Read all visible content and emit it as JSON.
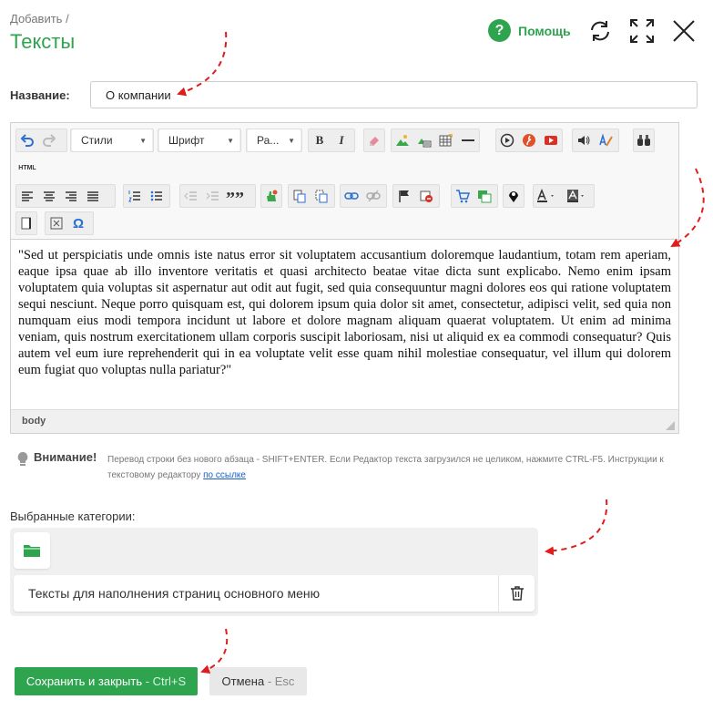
{
  "header": {
    "breadcrumb": "Добавить /",
    "title": "Тексты",
    "help_label": "Помощь",
    "help_icon": "question-circle-icon",
    "refresh_icon": "refresh-icon",
    "fullscreen_icon": "expand-icon",
    "close_icon": "close-icon",
    "accent_color": "#2ea44f"
  },
  "form": {
    "name_label": "Название:",
    "name_value": "О компании"
  },
  "editor": {
    "toolbar": {
      "styles_label": "Стили",
      "font_label": "Шрифт",
      "size_label": "Ра...",
      "bold": "B",
      "italic": "I",
      "html_label": "HTML",
      "quote": "””",
      "omega": "Ω"
    },
    "content": "\"Sed ut perspiciatis unde omnis iste natus error sit voluptatem accusantium doloremque laudantium, totam rem aperiam, eaque ipsa quae ab illo inventore veritatis et quasi architecto beatae vitae dicta sunt explicabo. Nemo enim ipsam voluptatem quia voluptas sit aspernatur aut odit aut fugit, sed quia consequuntur magni dolores eos qui ratione voluptatem sequi nesciunt. Neque porro quisquam est, qui dolorem ipsum quia dolor sit amet, consectetur, adipisci velit, sed quia non numquam eius modi tempora incidunt ut labore et dolore magnam aliquam quaerat voluptatem. Ut enim ad minima veniam, quis nostrum exercitationem ullam corporis suscipit laboriosam, nisi ut aliquid ex ea commodi consequatur? Quis autem vel eum iure reprehenderit qui in ea voluptate velit esse quam nihil molestiae consequatur, vel illum qui dolorem eum fugiat quo voluptas nulla pariatur?\"",
    "status_path": "body"
  },
  "notice": {
    "title": "Внимание!",
    "text": "Перевод строки без нового абзаца - SHIFT+ENTER. Если Редактор текста загрузился не целиком, нажмите CTRL-F5. Инструкции к текстовому редактору ",
    "link": "по ссылке"
  },
  "categories": {
    "label": "Выбранные категории:",
    "folder_icon": "folder-icon",
    "items": [
      {
        "label": "Тексты для наполнения страниц основного меню"
      }
    ],
    "delete_icon": "trash-icon"
  },
  "actions": {
    "save_label": "Сохранить и закрыть",
    "save_hint": " - Ctrl+S",
    "cancel_label": "Отмена",
    "cancel_hint": " - Esc"
  }
}
